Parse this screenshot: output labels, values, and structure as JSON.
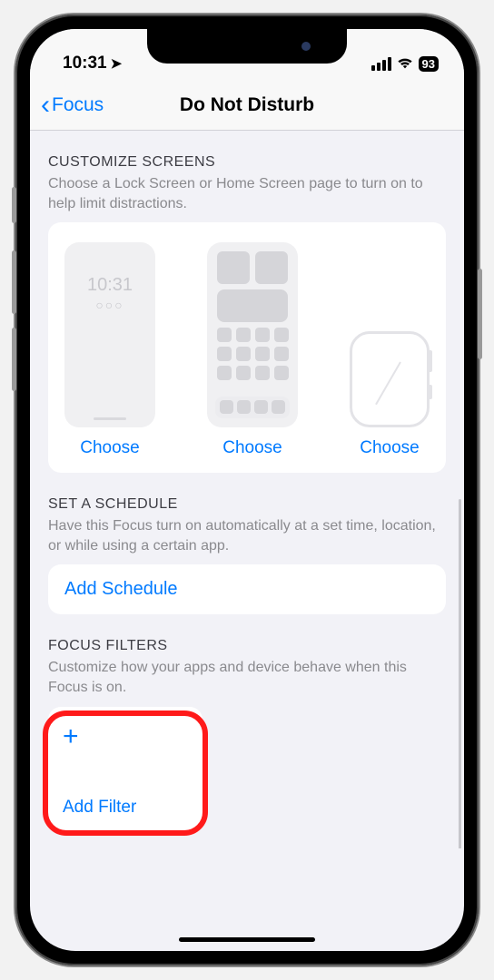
{
  "status": {
    "time": "10:31",
    "battery": "93"
  },
  "nav": {
    "back_label": "Focus",
    "title": "Do Not Disturb"
  },
  "customize": {
    "header": "CUSTOMIZE SCREENS",
    "sub": "Choose a Lock Screen or Home Screen page to turn on to help limit distractions.",
    "lock_time": "10:31",
    "choose_label": "Choose"
  },
  "schedule": {
    "header": "SET A SCHEDULE",
    "sub": "Have this Focus turn on automatically at a set time, location, or while using a certain app.",
    "add_label": "Add Schedule"
  },
  "filters": {
    "header": "FOCUS FILTERS",
    "sub": "Customize how your apps and device behave when this Focus is on.",
    "add_label": "Add Filter"
  }
}
